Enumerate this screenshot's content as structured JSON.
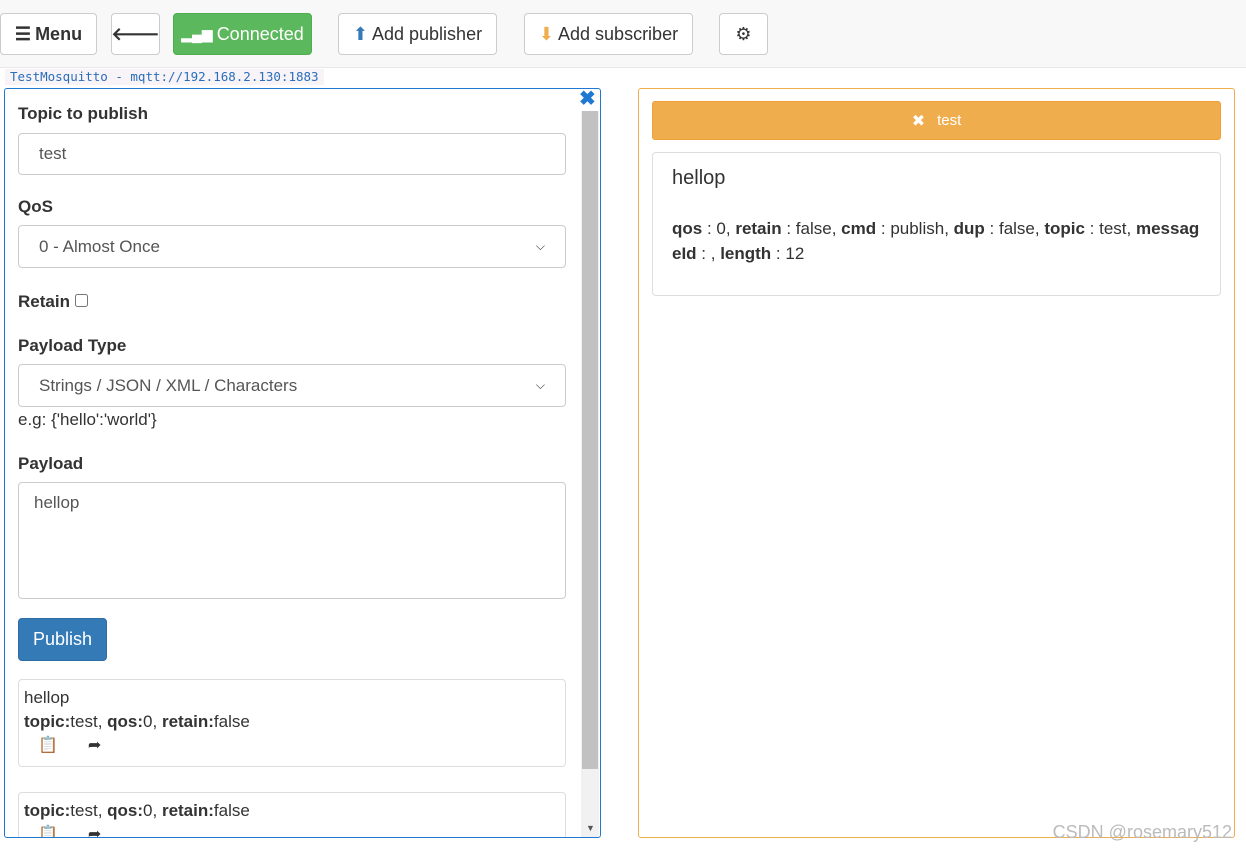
{
  "toolbar": {
    "menu": "Menu",
    "connected": "Connected",
    "add_publisher": "Add publisher",
    "add_subscriber": "Add subscriber"
  },
  "connection": "TestMosquitto - mqtt://192.168.2.130:1883",
  "publisher": {
    "topic_label": "Topic to publish",
    "topic_value": "test",
    "qos_label": "QoS",
    "qos_value": "0 - Almost Once",
    "retain_label": "Retain",
    "retain_checked": false,
    "payload_type_label": "Payload Type",
    "payload_type_value": "Strings / JSON / XML / Characters",
    "example": "e.g: {'hello':'world'}",
    "payload_label": "Payload",
    "payload_value": "hellop",
    "publish": "Publish",
    "history": [
      {
        "payload": "hellop",
        "topic": "test",
        "qos": "0",
        "retain": "false"
      },
      {
        "payload": "",
        "topic": "test",
        "qos": "0",
        "retain": "false"
      }
    ],
    "k_topic": "topic:",
    "k_qos": "qos:",
    "k_retain": "retain:"
  },
  "subscriber": {
    "topic": "test",
    "message": {
      "payload": "hellop",
      "qos": "0",
      "retain": "false",
      "cmd": "publish",
      "dup": "false",
      "topic": "test",
      "messageId": "",
      "length": "12"
    }
  },
  "watermark": "CSDN @rosemary512",
  "colors": {
    "connected": "#5cb85c",
    "subscriber": "#f0ad4e",
    "publisher": "#1f78d1",
    "publish_button": "#337ab7"
  }
}
